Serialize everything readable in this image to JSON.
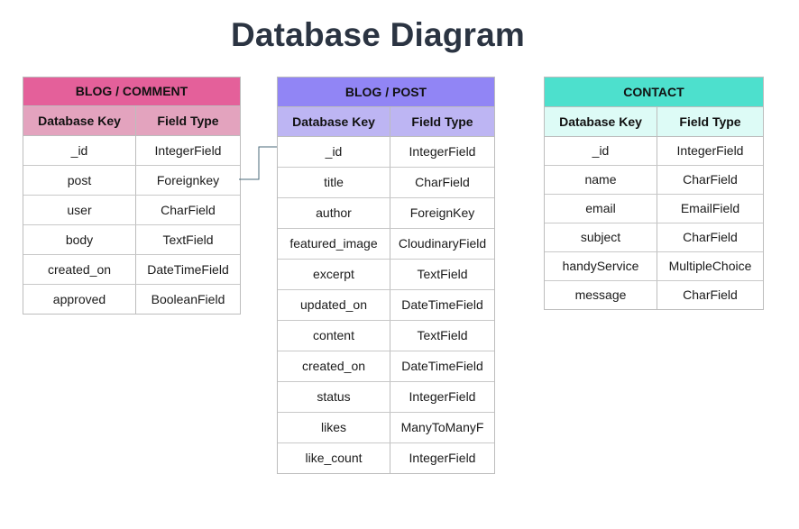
{
  "title": "Database Diagram",
  "tables": [
    {
      "id": "comment",
      "title": "BLOG / COMMENT",
      "header_color": "#e4609a",
      "subheader_color": "#e3a3be",
      "columns": [
        "Database Key",
        "Field Type"
      ],
      "rows": [
        [
          "_id",
          "IntegerField"
        ],
        [
          "post",
          "Foreignkey"
        ],
        [
          "user",
          "CharField"
        ],
        [
          "body",
          "TextField"
        ],
        [
          "created_on",
          "DateTimeField"
        ],
        [
          "approved",
          "BooleanField"
        ]
      ]
    },
    {
      "id": "post",
      "title": "BLOG / POST",
      "header_color": "#9185f5",
      "subheader_color": "#bdb5f3",
      "columns": [
        "Database Key",
        "Field Type"
      ],
      "rows": [
        [
          "_id",
          "IntegerField"
        ],
        [
          "title",
          "CharField"
        ],
        [
          "author",
          "ForeignKey"
        ],
        [
          "featured_image",
          "CloudinaryField"
        ],
        [
          "excerpt",
          "TextField"
        ],
        [
          "updated_on",
          "DateTimeField"
        ],
        [
          "content",
          "TextField"
        ],
        [
          "created_on",
          "DateTimeField"
        ],
        [
          "status",
          "IntegerField"
        ],
        [
          "likes",
          "ManyToManyF"
        ],
        [
          "like_count",
          "IntegerField"
        ]
      ]
    },
    {
      "id": "contact",
      "title": "CONTACT",
      "header_color": "#4de0cd",
      "subheader_color": "#ddfbf6",
      "columns": [
        "Database Key",
        "Field Type"
      ],
      "rows": [
        [
          "_id",
          "IntegerField"
        ],
        [
          "name",
          "CharField"
        ],
        [
          "email",
          "EmailField"
        ],
        [
          "subject",
          "CharField"
        ],
        [
          "handyService",
          "MultipleChoice"
        ],
        [
          "message",
          "CharField"
        ]
      ]
    }
  ],
  "connector_color": "#4a6a7a"
}
